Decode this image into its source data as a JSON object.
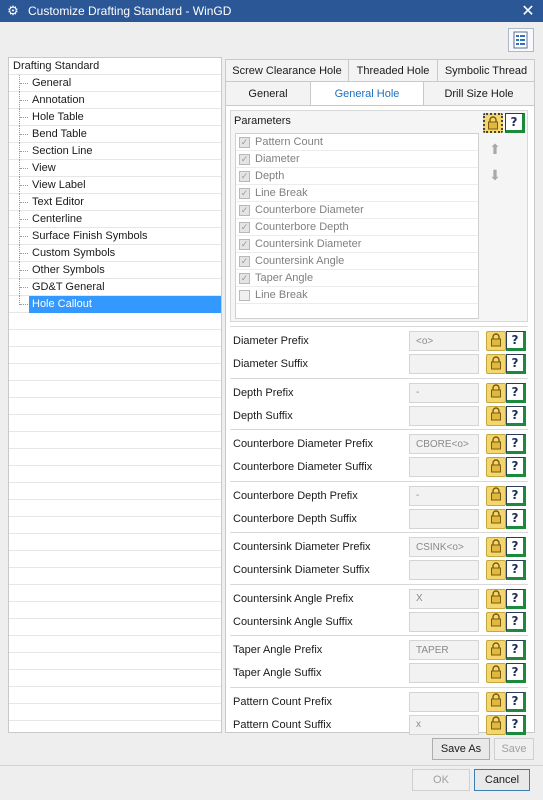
{
  "window": {
    "title": "Customize Drafting Standard - WinGD"
  },
  "tree": {
    "root": "Drafting Standard",
    "items": [
      {
        "label": "General"
      },
      {
        "label": "Annotation"
      },
      {
        "label": "Hole Table"
      },
      {
        "label": "Bend Table"
      },
      {
        "label": "Section Line"
      },
      {
        "label": "View"
      },
      {
        "label": "View Label"
      },
      {
        "label": "Text Editor"
      },
      {
        "label": "Centerline"
      },
      {
        "label": "Surface Finish Symbols"
      },
      {
        "label": "Custom Symbols"
      },
      {
        "label": "Other Symbols"
      },
      {
        "label": "GD&T General"
      },
      {
        "label": "Hole Callout"
      }
    ],
    "selected": "Hole Callout"
  },
  "tabs": {
    "row1": [
      "Screw Clearance Hole",
      "Threaded Hole",
      "Symbolic Thread"
    ],
    "row2": [
      "General",
      "General Hole",
      "Drill Size Hole"
    ],
    "active": "General Hole"
  },
  "parameters": {
    "label": "Parameters",
    "items": [
      {
        "label": "Pattern Count",
        "checked": true
      },
      {
        "label": "Diameter",
        "checked": true
      },
      {
        "label": "Depth",
        "checked": true
      },
      {
        "label": "Line Break",
        "checked": true
      },
      {
        "label": "Counterbore Diameter",
        "checked": true
      },
      {
        "label": "Counterbore Depth",
        "checked": true
      },
      {
        "label": "Countersink Diameter",
        "checked": true
      },
      {
        "label": "Countersink Angle",
        "checked": true
      },
      {
        "label": "Taper Angle",
        "checked": true
      },
      {
        "label": "Line Break",
        "checked": false
      }
    ]
  },
  "fields": [
    {
      "label": "Diameter Prefix",
      "value": "<o>"
    },
    {
      "label": "Diameter Suffix",
      "value": ""
    },
    {
      "label": "Depth Prefix",
      "value": "-"
    },
    {
      "label": "Depth Suffix",
      "value": ""
    },
    {
      "label": "Counterbore Diameter Prefix",
      "value": "CBORE<o>"
    },
    {
      "label": "Counterbore Diameter Suffix",
      "value": ""
    },
    {
      "label": "Counterbore Depth Prefix",
      "value": "-"
    },
    {
      "label": "Counterbore Depth Suffix",
      "value": ""
    },
    {
      "label": "Countersink Diameter Prefix",
      "value": "CSINK<o>"
    },
    {
      "label": "Countersink Diameter Suffix",
      "value": ""
    },
    {
      "label": "Countersink Angle Prefix",
      "value": "X"
    },
    {
      "label": "Countersink Angle Suffix",
      "value": ""
    },
    {
      "label": "Taper Angle Prefix",
      "value": "TAPER"
    },
    {
      "label": "Taper Angle Suffix",
      "value": ""
    },
    {
      "label": "Pattern Count Prefix",
      "value": ""
    },
    {
      "label": "Pattern Count Suffix",
      "value": "x"
    }
  ],
  "buttons": {
    "save_as": "Save As",
    "save": "Save",
    "ok": "OK",
    "cancel": "Cancel",
    "help_glyph": "?"
  },
  "colors": {
    "titlebar": "#2b5797",
    "selection": "#3399ff",
    "lock": "#f3d76e"
  }
}
